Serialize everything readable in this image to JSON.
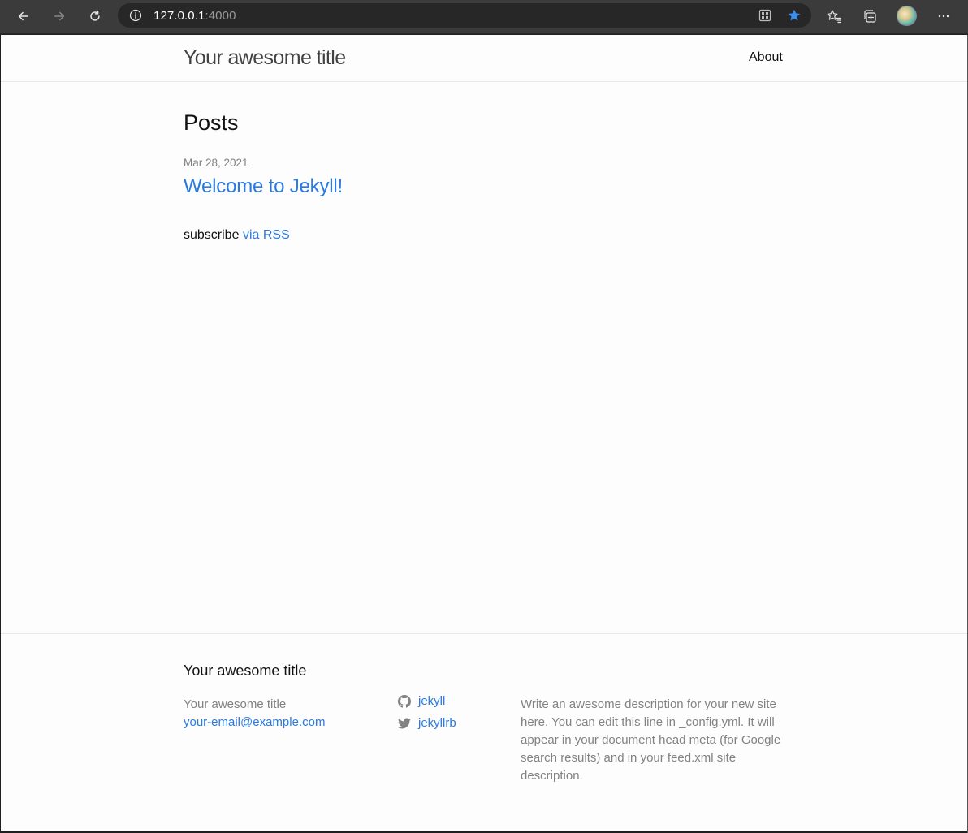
{
  "browser": {
    "url_host": "127.0.0.1",
    "url_port": ":4000",
    "icons": [
      "back-arrow-icon",
      "forward-arrow-icon",
      "refresh-icon",
      "info-icon",
      "apps-grid-icon",
      "favorite-star-icon",
      "favorites-list-icon",
      "collections-icon",
      "profile-avatar",
      "more-menu-icon"
    ],
    "accent_star": "#3b8eea"
  },
  "header": {
    "site_title": "Your awesome title",
    "nav_about": "About"
  },
  "main": {
    "heading": "Posts",
    "posts": [
      {
        "date": "Mar 28, 2021",
        "title": "Welcome to Jekyll!"
      }
    ],
    "rss_prefix": "subscribe",
    "rss_link": "via RSS"
  },
  "footer": {
    "heading": "Your awesome title",
    "name": "Your awesome title",
    "email": "your-email@example.com",
    "github": "jekyll",
    "twitter": "jekyllrb",
    "description": "Write an awesome description for your new site here. You can edit this line in _config.yml. It will appear in your document head meta (for Google search results) and in your feed.xml site description."
  },
  "colors": {
    "link": "#2a7ae2",
    "muted": "#828282",
    "text": "#111111",
    "background": "#fdfdfd"
  }
}
